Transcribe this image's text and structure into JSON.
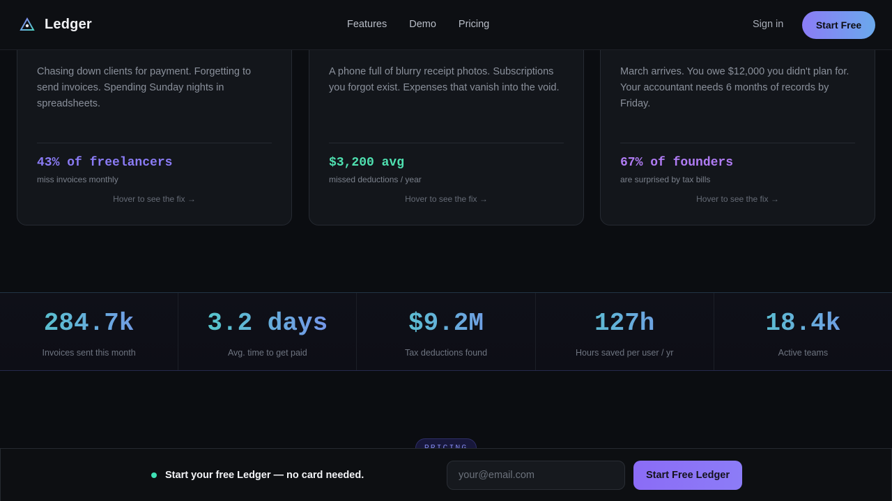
{
  "nav": {
    "brand": "Ledger",
    "links": [
      "Features",
      "Demo",
      "Pricing"
    ],
    "signin": "Sign in",
    "cta": "Start Free"
  },
  "cards": [
    {
      "desc": "Chasing down clients for payment. Forgetting to send invoices. Spending Sunday nights in spreadsheets.",
      "stat": "43% of freelancers",
      "sub": "miss invoices monthly",
      "hint": "Hover to see the fix →",
      "color": "#8b7cf6"
    },
    {
      "desc": "A phone full of blurry receipt photos. Subscriptions you forgot exist. Expenses that vanish into the void.",
      "stat": "$3,200 avg",
      "sub": "missed deductions / year",
      "hint": "Hover to see the fix →",
      "color": "#4fe0b0"
    },
    {
      "desc": "March arrives. You owe $12,000 you didn't plan for. Your accountant needs 6 months of records by Friday.",
      "stat": "67% of founders",
      "sub": "are surprised by tax bills",
      "hint": "Hover to see the fix →",
      "color": "#b07cf4"
    }
  ],
  "metrics": [
    {
      "value": "284.7k",
      "label": "Invoices sent this month"
    },
    {
      "value": "3.2 days",
      "label": "Avg. time to get paid"
    },
    {
      "value": "$9.2M",
      "label": "Tax deductions found"
    },
    {
      "value": "127h",
      "label": "Hours saved per user / yr"
    },
    {
      "value": "18.4k",
      "label": "Active teams"
    }
  ],
  "pricing_pill": "PRICING",
  "cta_bar": {
    "text": "Start your free Ledger — no card needed.",
    "email_placeholder": "your@email.com",
    "button": "Start Free Ledger"
  },
  "colors": {
    "accent": "#8b7cf6",
    "teal": "#4fd1c5",
    "status_dot": "#3ee0b4"
  }
}
